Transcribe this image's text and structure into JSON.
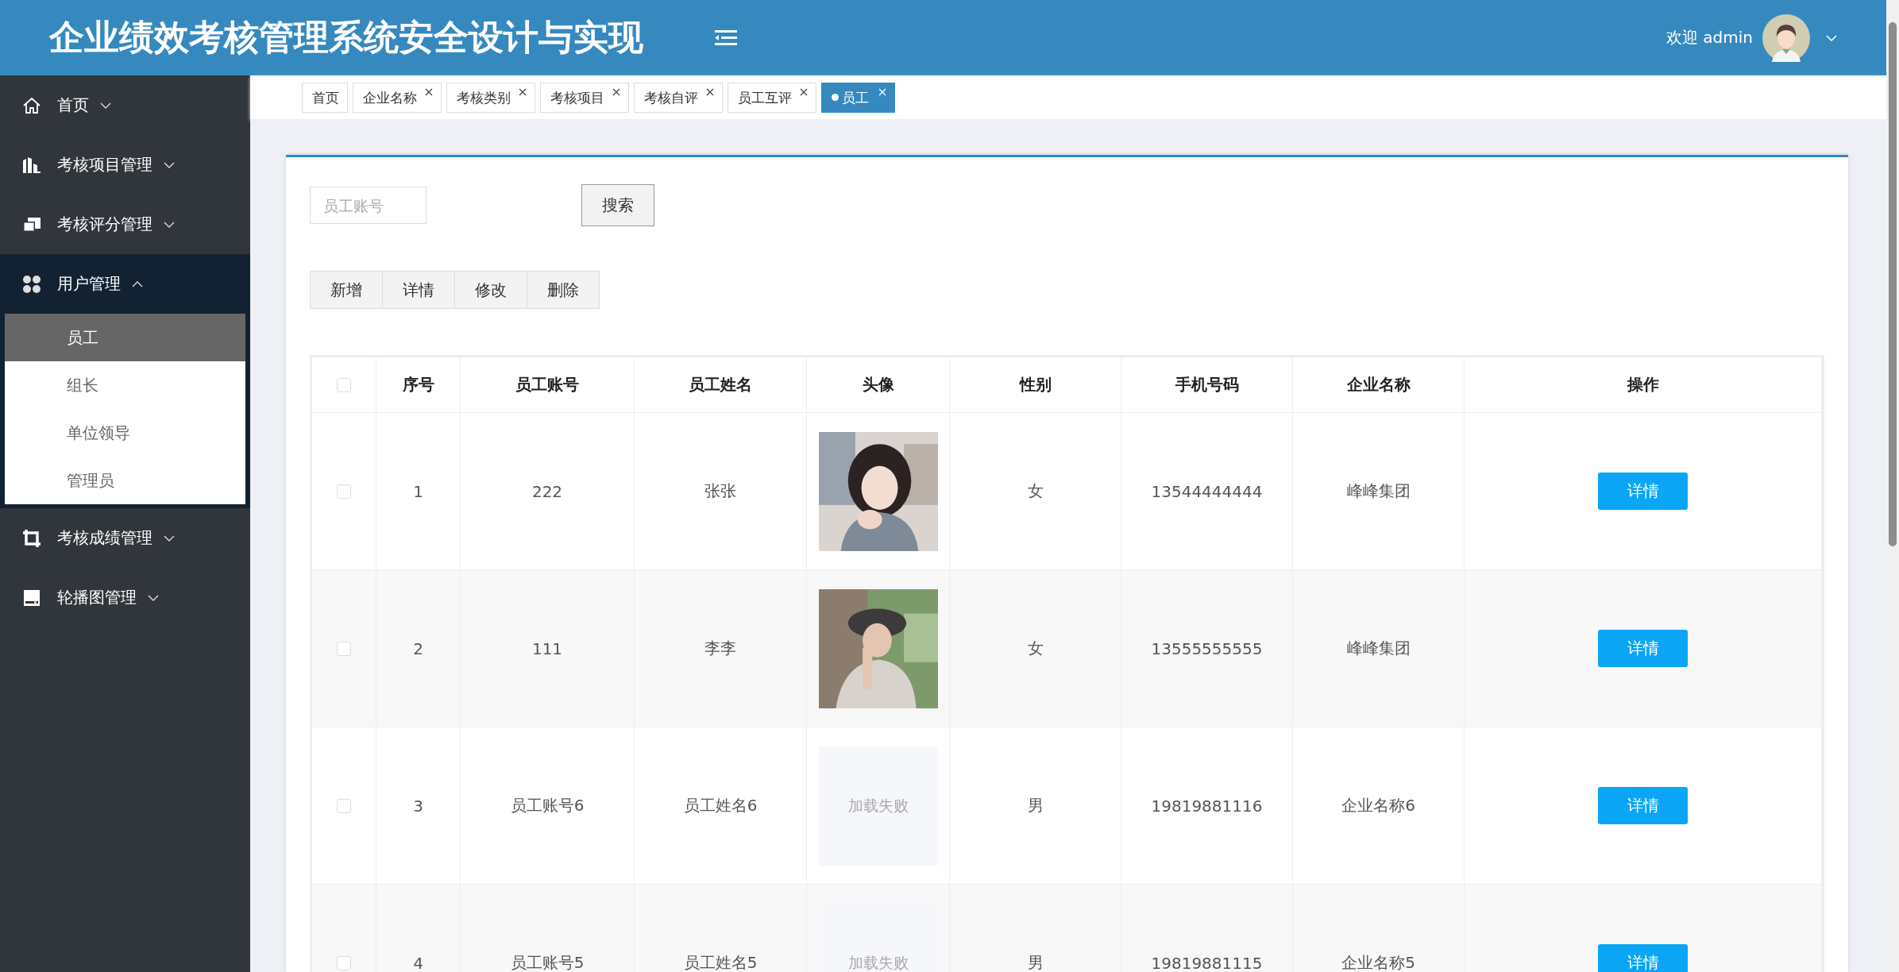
{
  "header": {
    "title": "企业绩效考核管理系统安全设计与实现",
    "welcome": "欢迎 admin"
  },
  "sidebar": {
    "items": [
      {
        "label": "首页",
        "expanded": false
      },
      {
        "label": "考核项目管理",
        "expanded": false
      },
      {
        "label": "考核评分管理",
        "expanded": false
      },
      {
        "label": "用户管理",
        "expanded": true,
        "children": [
          {
            "label": "员工",
            "selected": true
          },
          {
            "label": "组长",
            "selected": false
          },
          {
            "label": "单位领导",
            "selected": false
          },
          {
            "label": "管理员",
            "selected": false
          }
        ]
      },
      {
        "label": "考核成绩管理",
        "expanded": false
      },
      {
        "label": "轮播图管理",
        "expanded": false
      }
    ]
  },
  "tabs": [
    {
      "label": "首页",
      "closable": false,
      "selected": false
    },
    {
      "label": "企业名称",
      "closable": true,
      "selected": false
    },
    {
      "label": "考核类别",
      "closable": true,
      "selected": false
    },
    {
      "label": "考核项目",
      "closable": true,
      "selected": false
    },
    {
      "label": "考核自评",
      "closable": true,
      "selected": false
    },
    {
      "label": "员工互评",
      "closable": true,
      "selected": false
    },
    {
      "label": "员工",
      "closable": true,
      "selected": true
    }
  ],
  "search": {
    "placeholder": "员工账号",
    "button": "搜索"
  },
  "actions": [
    "新增",
    "详情",
    "修改",
    "删除"
  ],
  "table": {
    "select_all": {
      "checked": false
    },
    "columns": [
      "序号",
      "员工账号",
      "员工姓名",
      "头像",
      "性别",
      "手机号码",
      "企业名称",
      "操作"
    ],
    "rows": [
      {
        "checked": false,
        "index": "1",
        "account": "222",
        "name": "张张",
        "gender": "女",
        "phone": "13544444444",
        "company": "峰峰集团",
        "action": "详情"
      },
      {
        "checked": false,
        "index": "2",
        "account": "111",
        "name": "李李",
        "gender": "女",
        "phone": "13555555555",
        "company": "峰峰集团",
        "action": "详情"
      },
      {
        "checked": false,
        "index": "3",
        "account": "员工账号6",
        "name": "员工姓名6",
        "avatar": {
          "kind": "failed",
          "text": "加载失败"
        },
        "gender": "男",
        "phone": "19819881116",
        "company": "企业名称6",
        "action": "详情"
      },
      {
        "checked": false,
        "index": "4",
        "account": "员工账号5",
        "name": "员工姓名5",
        "avatar": {
          "kind": "failed",
          "text": "加载失败"
        },
        "gender": "男",
        "phone": "19819881115",
        "company": "企业名称5",
        "action": "详情"
      }
    ]
  }
}
